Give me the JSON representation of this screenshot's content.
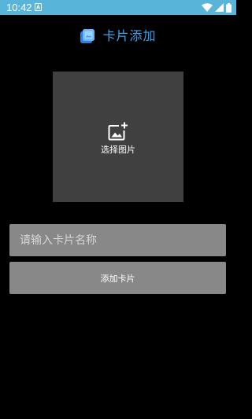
{
  "status_bar": {
    "time": "10:42",
    "background_color": "#58b5d9",
    "icons": [
      "notification-icon",
      "wifi-icon",
      "signal-icon",
      "battery-icon"
    ]
  },
  "header": {
    "title": "卡片添加",
    "title_color": "#3da2ee",
    "logo_icon": "cards-logo-icon"
  },
  "image_picker": {
    "label": "选择图片",
    "icon": "add-photo-icon",
    "background_color": "#404040"
  },
  "name_input": {
    "placeholder": "请输入卡片名称",
    "value": ""
  },
  "add_button": {
    "label": "添加卡片"
  }
}
